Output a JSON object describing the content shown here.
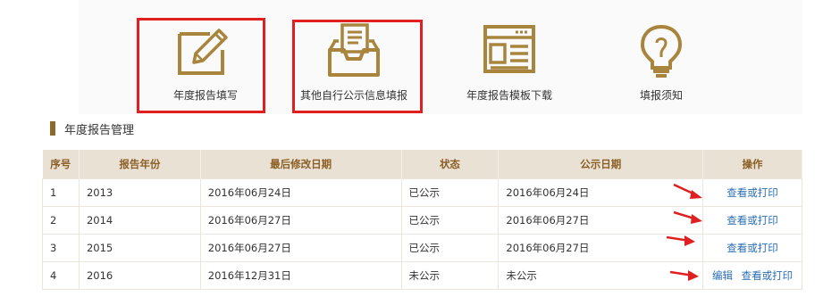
{
  "toolbar": {
    "items": [
      {
        "label": "年度报告填写",
        "icon": "pencil-edit-icon"
      },
      {
        "label": "其他自行公示信息填报",
        "icon": "inbox-tray-icon"
      },
      {
        "label": "年度报告模板下载",
        "icon": "template-window-icon"
      },
      {
        "label": "填报须知",
        "icon": "lightbulb-icon"
      }
    ]
  },
  "section": {
    "title": "年度报告管理"
  },
  "table": {
    "headers": [
      "序号",
      "报告年份",
      "最后修改日期",
      "状态",
      "公示日期",
      "操作"
    ],
    "rows": [
      {
        "no": "1",
        "year": "2013",
        "modified": "2016年06月24日",
        "status": "已公示",
        "publish": "2016年06月24日",
        "edit": "",
        "view": "查看或打印"
      },
      {
        "no": "2",
        "year": "2014",
        "modified": "2016年06月27日",
        "status": "已公示",
        "publish": "2016年06月27日",
        "edit": "",
        "view": "查看或打印"
      },
      {
        "no": "3",
        "year": "2015",
        "modified": "2016年06月27日",
        "status": "已公示",
        "publish": "2016年06月27日",
        "edit": "",
        "view": "查看或打印"
      },
      {
        "no": "4",
        "year": "2016",
        "modified": "2016年12月31日",
        "status": "未公示",
        "publish": "未公示",
        "edit": "编辑",
        "view": "查看或打印"
      }
    ]
  },
  "colors": {
    "accent": "#a8843c",
    "highlight": "#e02020",
    "link": "#2a6db5",
    "header_bg": "#e9e1d4",
    "header_text": "#8b5e25"
  }
}
